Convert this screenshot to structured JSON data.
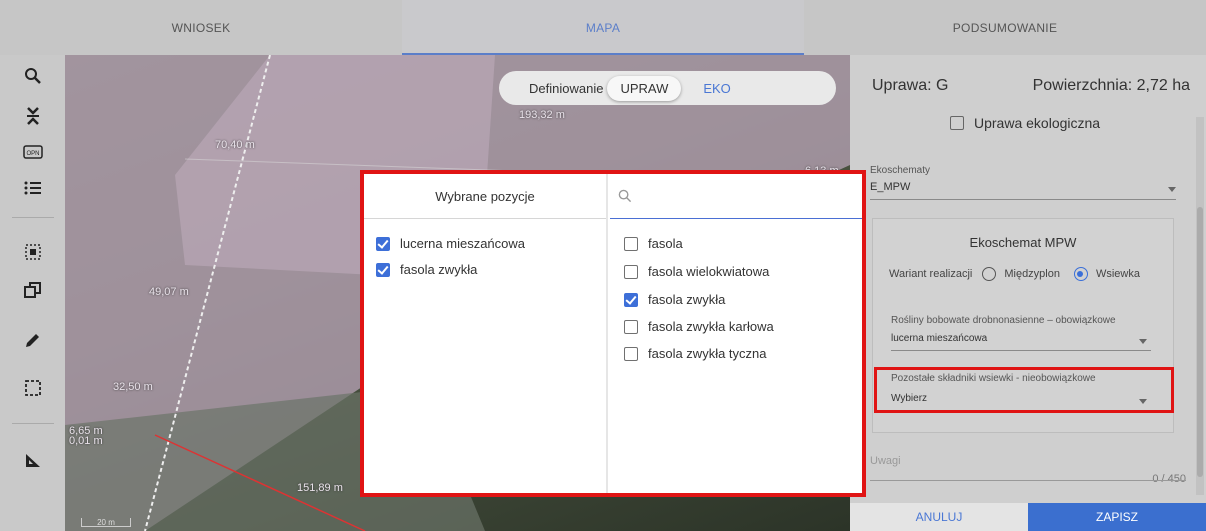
{
  "tabs": [
    "WNIOSEK",
    "MAPA",
    "PODSUMOWANIE"
  ],
  "map": {
    "toggle_label": "Definiowanie",
    "toggle_active": "UPRAW",
    "toggle_other": "EKO",
    "labels": [
      "193,32 m",
      "70,40 m",
      "6,13 m",
      "49,07 m",
      "32,50 m",
      "6,65 m",
      "0,01 m",
      "151,89 m"
    ],
    "scale": "20 m"
  },
  "panel": {
    "crop": "Uprawa: G",
    "area": "Powierzchnia: 2,72 ha",
    "eco_crop_label": "Uprawa ekologiczna",
    "ecoschemes_label": "Ekoschematy",
    "ecoschemes_value": "E_MPW",
    "card_title": "Ekoschemat MPW",
    "variant_label": "Wariant realizacji",
    "variant_option_1": "Międzyplon",
    "variant_option_2": "Wsiewka",
    "required_label": "Rośliny bobowate drobnonasienne – obowiązkowe",
    "required_value": "lucerna mieszańcowa",
    "optional_label": "Pozostałe składniki wsiewki - nieobowiązkowe",
    "optional_value": "Wybierz",
    "notes_label": "Uwagi",
    "counter": "0 / 450",
    "cancel": "ANULUJ",
    "save": "ZAPISZ"
  },
  "dialog": {
    "selected_title": "Wybrane pozycje",
    "search_value": "",
    "selected": [
      "lucerna mieszańcowa",
      "fasola zwykła"
    ],
    "options": [
      {
        "label": "fasola",
        "checked": false
      },
      {
        "label": "fasola wielokwiatowa",
        "checked": false
      },
      {
        "label": "fasola zwykła",
        "checked": true
      },
      {
        "label": "fasola zwykła karłowa",
        "checked": false
      },
      {
        "label": "fasola zwykła tyczna",
        "checked": false
      }
    ]
  },
  "colors": {
    "accent": "#3b6fcf",
    "highlight": "#e01414"
  }
}
